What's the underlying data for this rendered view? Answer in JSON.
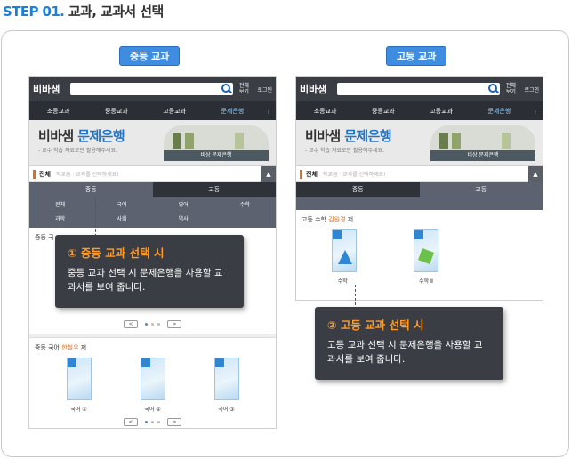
{
  "title": {
    "step": "STEP 01.",
    "text": "교과, 교과서 선택"
  },
  "app": {
    "logo": "비바샘",
    "all_view": "전체 보기",
    "login": "로그인",
    "nav": [
      "초등교과",
      "중등교과",
      "고등교과",
      "문제은행"
    ],
    "more": "⋮",
    "banner_title_prefix": "비바샘",
    "banner_title_accent": "문제은행",
    "banner_sub": "- 교수 학습 자료로만 활용해주세요.",
    "banner_caption": "비상 문제은행",
    "search_label": "전체",
    "search_placeholder": "학교급 · 교과를 선택하세요!",
    "collapse": "▲",
    "tab_middle": "중등",
    "tab_high": "고등",
    "prev": "<",
    "next": ">"
  },
  "middle": {
    "tag": "중등 교과",
    "subjects": [
      "전체",
      "국어",
      "영어",
      "수학",
      "과학",
      "사회",
      "역사"
    ],
    "section_partial": "중등 국",
    "section2": {
      "subject": "중등 국어",
      "author": "한철우",
      "suffix": "저"
    },
    "books": [
      "국어 ①",
      "국어 ②",
      "국어 ③"
    ]
  },
  "high": {
    "tag": "고등 교과",
    "section": {
      "subject": "고등 수학",
      "author": "김원경",
      "suffix": "저"
    },
    "books": [
      "수학 Ⅰ",
      "수학 Ⅱ"
    ]
  },
  "callouts": {
    "middle": {
      "title": "① 중등 교과 선택 시",
      "desc": "중등 교과 선택 시 문제은행을 사용할 교과서를 보여 줍니다."
    },
    "high": {
      "title": "② 고등 교과 선택 시",
      "desc": "고등 교과 선택 시 문제은행을 사용할 교과서를 보여 줍니다."
    }
  }
}
